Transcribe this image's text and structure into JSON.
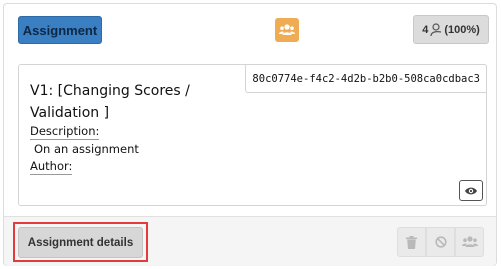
{
  "header": {
    "type_label": "Assignment",
    "group_icon": "group-icon",
    "count": "4",
    "percent": "(100%)",
    "colors": {
      "type_badge": "#3a7fc1",
      "group_badge": "#f0ac55"
    }
  },
  "assignment": {
    "uuid": "80c0774e-f4c2-4d2b-b2b0-508ca0cdbac3",
    "title": "V1: [Changing Scores / Validation ]",
    "description_label": "Description:",
    "description_value": "On an assignment",
    "author_label": "Author:",
    "author_value": ""
  },
  "footer": {
    "details_button": "Assignment details",
    "actions": [
      "trash-icon",
      "ban-icon",
      "users-icon"
    ],
    "highlight_color": "#e23b3b"
  }
}
